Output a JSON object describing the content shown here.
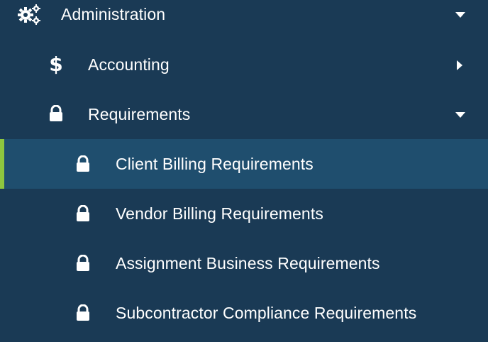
{
  "menu": {
    "items": [
      {
        "label": "Administration",
        "icon": "gears-icon",
        "caret": "down",
        "level": 0
      },
      {
        "label": "Accounting",
        "icon": "dollar-icon",
        "icon_glyph": "$",
        "caret": "right",
        "level": 1
      },
      {
        "label": "Requirements",
        "icon": "lock-icon",
        "caret": "down",
        "level": 1
      },
      {
        "label": "Client Billing Requirements",
        "icon": "lock-icon",
        "level": 2,
        "active": true
      },
      {
        "label": "Vendor Billing Requirements",
        "icon": "lock-icon",
        "level": 2
      },
      {
        "label": "Assignment Business Requirements",
        "icon": "lock-icon",
        "level": 2
      },
      {
        "label": "Subcontractor Compliance Requirements",
        "icon": "lock-icon",
        "level": 2
      }
    ]
  },
  "colors": {
    "background": "#1a3a55",
    "active_background": "#1f4e6e",
    "active_accent": "#8dc63f",
    "text": "#ffffff"
  }
}
